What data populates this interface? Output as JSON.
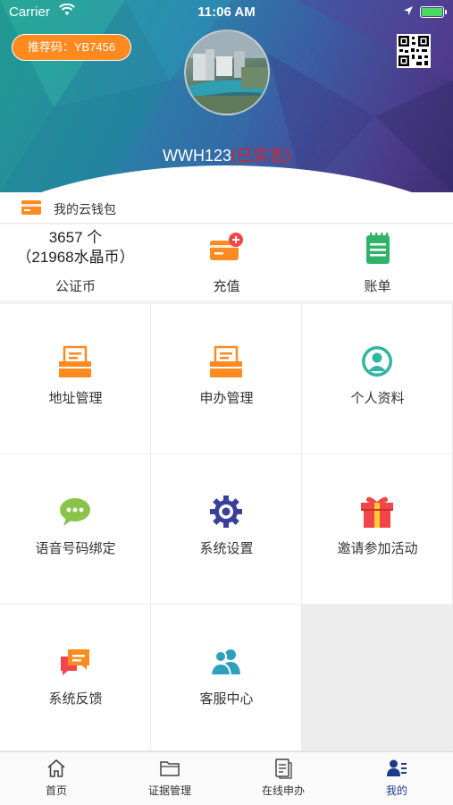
{
  "status_bar": {
    "carrier": "Carrier",
    "time": "11:06 AM"
  },
  "profile": {
    "referral_code": "推荐码：YB7456",
    "username": "WWH123",
    "verified_label": "(已实名)"
  },
  "wallet": {
    "title": "我的云钱包",
    "coins": {
      "count": "3657 个",
      "crystal": "（21968水晶币）",
      "label": "公证币"
    },
    "recharge_label": "充值",
    "bill_label": "账单"
  },
  "menu": {
    "address": "地址管理",
    "apply": "申办管理",
    "profile": "个人资料",
    "voice": "语音号码绑定",
    "settings": "系统设置",
    "invite": "邀请参加活动",
    "feedback": "系统反馈",
    "service": "客服中心"
  },
  "tabs": {
    "home": "首页",
    "evidence": "证据管理",
    "online": "在线申办",
    "mine": "我的"
  },
  "colors": {
    "orange": "#ff8a1f",
    "green": "#2fb36b",
    "active_tab": "#1f3a8a",
    "verified": "#e0201e"
  }
}
